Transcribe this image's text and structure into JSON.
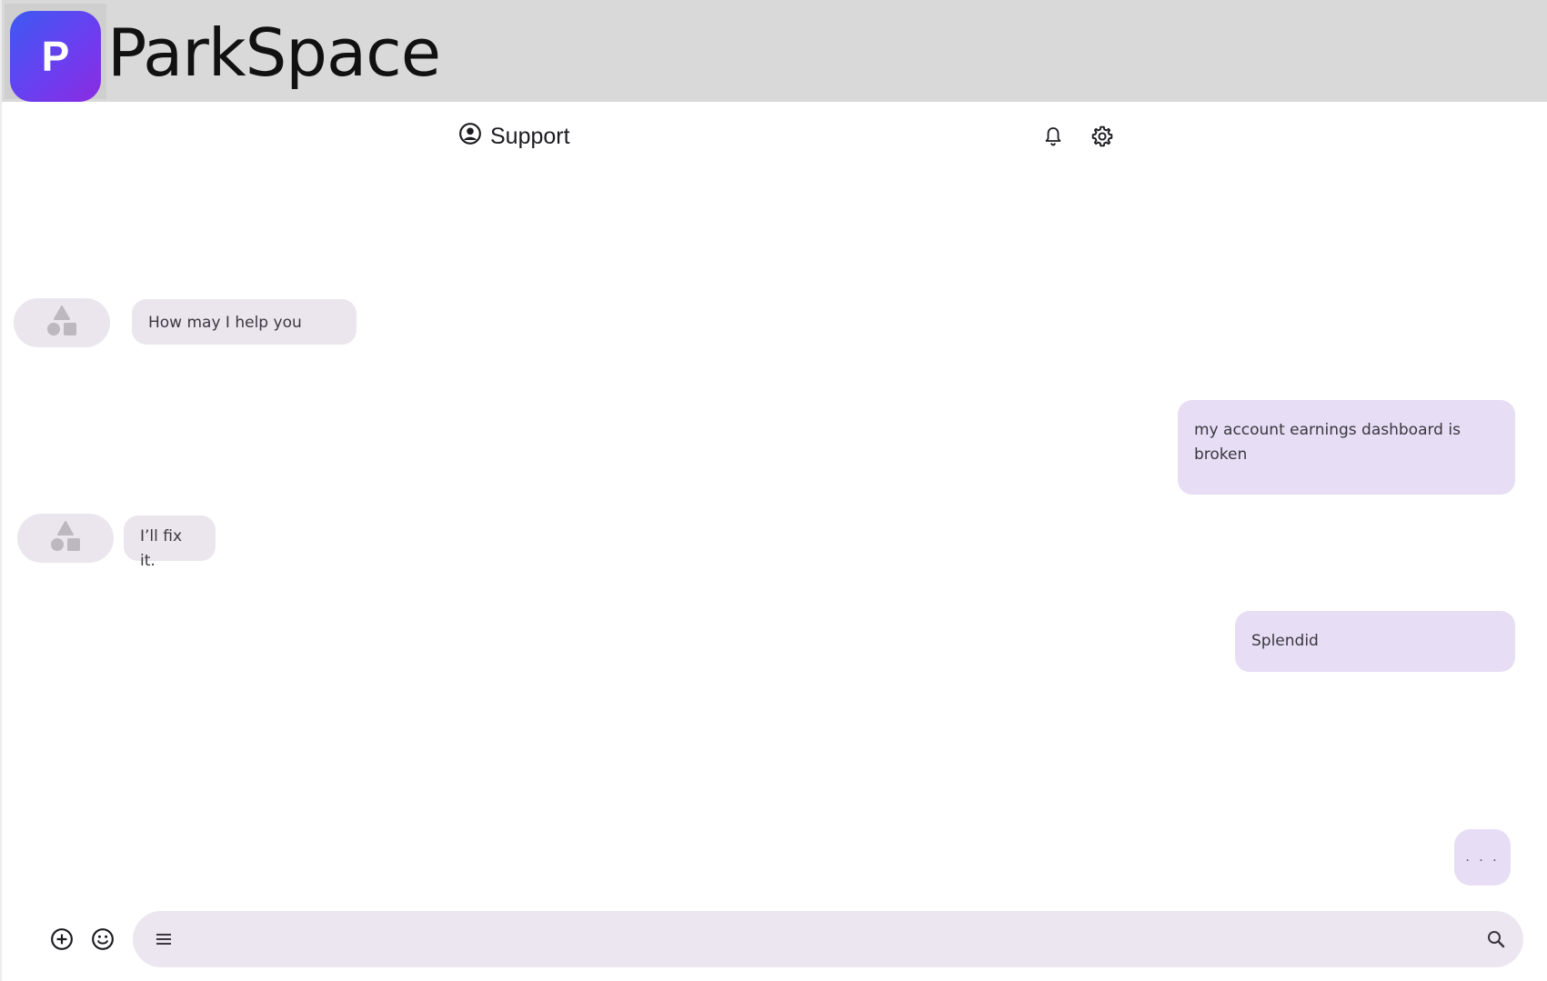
{
  "app": {
    "logo_letter": "P",
    "name": "ParkSpace",
    "brand_gradient": [
      "#3d5af1",
      "#8b2be0"
    ]
  },
  "header": {
    "title": "Support",
    "title_icon": "account-circle-icon",
    "actions": [
      "bell-icon",
      "gear-icon"
    ]
  },
  "messages": [
    {
      "from": "agent",
      "text": "How may I help you"
    },
    {
      "from": "user",
      "text": "my account earnings dashboard is broken"
    },
    {
      "from": "agent",
      "text": "I’ll fix it."
    },
    {
      "from": "user",
      "text": "Splendid"
    }
  ],
  "typing_indicator": ". . .",
  "composer": {
    "placeholder": "",
    "value": "",
    "left_actions": [
      "add-circle-icon",
      "emoji-icon"
    ],
    "menu_icon": "menu-icon",
    "search_icon": "search-icon"
  },
  "colors": {
    "appbar": "#d9d9d9",
    "incoming_bubble": "#ebe6ee",
    "outgoing_bubble": "#e7ddf4",
    "composer": "#ece6f0"
  }
}
